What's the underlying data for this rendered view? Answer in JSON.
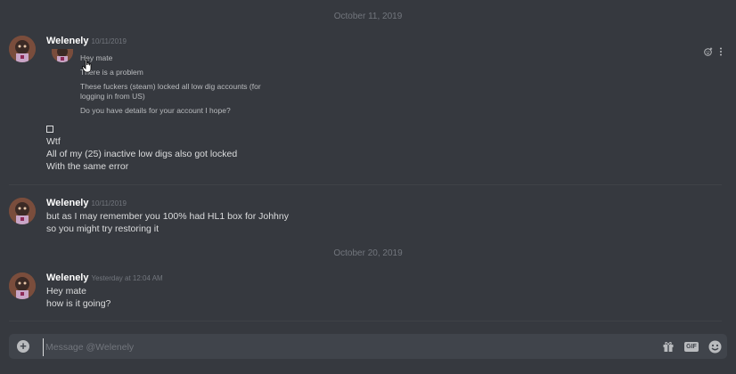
{
  "dividers": [
    {
      "label": "October 11, 2019"
    },
    {
      "label": "October 20, 2019"
    }
  ],
  "messages": [
    {
      "username": "Welenely",
      "timestamp": "10/11/2019",
      "embed": {
        "lines": [
          "Hey mate",
          "There is a problem",
          "These fuckers (steam) locked all low dig accounts (for",
          "logging in from US)",
          "Do you have details for your account I hope?"
        ]
      },
      "lines": [
        "Wtf",
        "All of my (25) inactive low digs also got locked",
        "With the same error"
      ]
    },
    {
      "username": "Welenely",
      "timestamp": "10/11/2019",
      "lines": [
        "but as I may remember you 100% had HL1 box for Johhny",
        "so you might try restoring it"
      ]
    },
    {
      "username": "Welenely",
      "timestamp": "Yesterday at 12:04 AM",
      "lines": [
        "Hey mate",
        "how is it going?"
      ]
    }
  ],
  "composer": {
    "placeholder": "Message @Welenely"
  },
  "icons": {
    "add": "plus-circle-icon",
    "gift": "gift-icon",
    "gif": "GIF",
    "emoji": "smile-icon",
    "react": "add-reaction-icon",
    "more": "more-vertical-icon"
  },
  "colors": {
    "background": "#36393f",
    "input": "#40444b",
    "username": "#ffffff",
    "muted": "#72767d"
  }
}
